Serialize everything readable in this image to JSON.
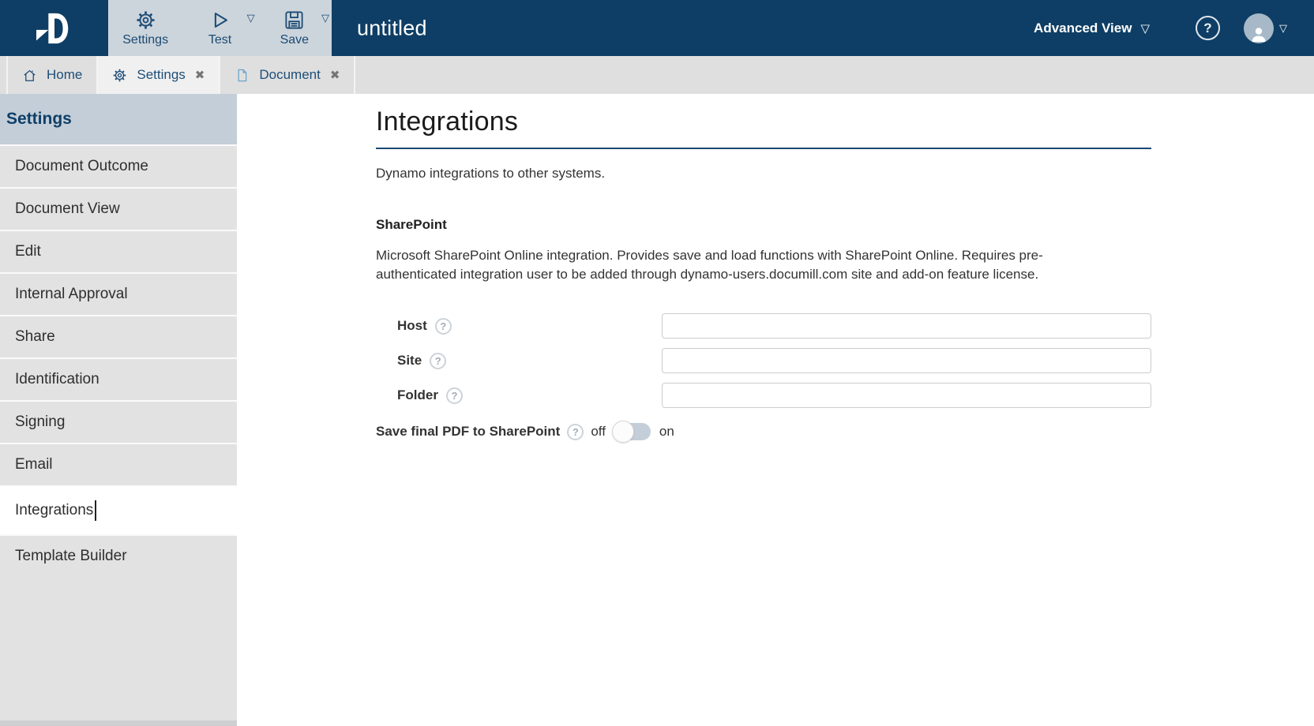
{
  "glyphs": {
    "help": "?",
    "close": "✖",
    "chevron_down": "▽"
  },
  "navbar": {
    "document_title": "untitled",
    "toolbar": {
      "settings": {
        "label": "Settings",
        "icon": "gear-icon"
      },
      "test": {
        "label": "Test",
        "icon": "play-icon"
      },
      "save": {
        "label": "Save",
        "icon": "save-icon"
      }
    },
    "view_mode": {
      "label": "Advanced View"
    }
  },
  "tabbar": {
    "tabs": [
      {
        "label": "Home",
        "icon": "home-icon",
        "closable": false,
        "active": false
      },
      {
        "label": "Settings",
        "icon": "gear-icon",
        "closable": true,
        "active": true
      },
      {
        "label": "Document",
        "icon": "document-icon",
        "closable": true,
        "active": false
      }
    ]
  },
  "sidebar": {
    "header": "Settings",
    "items": [
      "Document Outcome",
      "Document View",
      "Edit",
      "Internal Approval",
      "Share",
      "Identification",
      "Signing",
      "Email",
      "Integrations",
      "Template Builder"
    ],
    "selected_item": "Integrations"
  },
  "main": {
    "title": "Integrations",
    "subtitle": "Dynamo integrations to other systems.",
    "sharepoint": {
      "title": "SharePoint",
      "description": "Microsoft SharePoint Online integration. Provides save and load functions with SharePoint Online. Requires pre-authenticated integration user to be added through dynamo-users.documill.com site and add-on feature license.",
      "fields": [
        {
          "label": "Host",
          "value": ""
        },
        {
          "label": "Site",
          "value": ""
        },
        {
          "label": "Folder",
          "value": ""
        }
      ],
      "toggle": {
        "label": "Save final PDF to SharePoint",
        "off_label": "off",
        "on_label": "on",
        "state": "off"
      }
    }
  },
  "colors": {
    "navbar_bg": "#0e3e65",
    "toolbar_panel_bg": "#ccd5dc",
    "accent_navy": "#1b4a73",
    "tabbar_bg": "#dfdfdf",
    "active_tab_bg": "#f0f0f0",
    "sidebar_header_bg": "#c3ced8",
    "sidebar_item_bg": "#e2e2e2",
    "selected_item_bg": "#ffffff",
    "toggle_track": "#c3ced8",
    "document_icon_blue": "#6aa5cd"
  }
}
